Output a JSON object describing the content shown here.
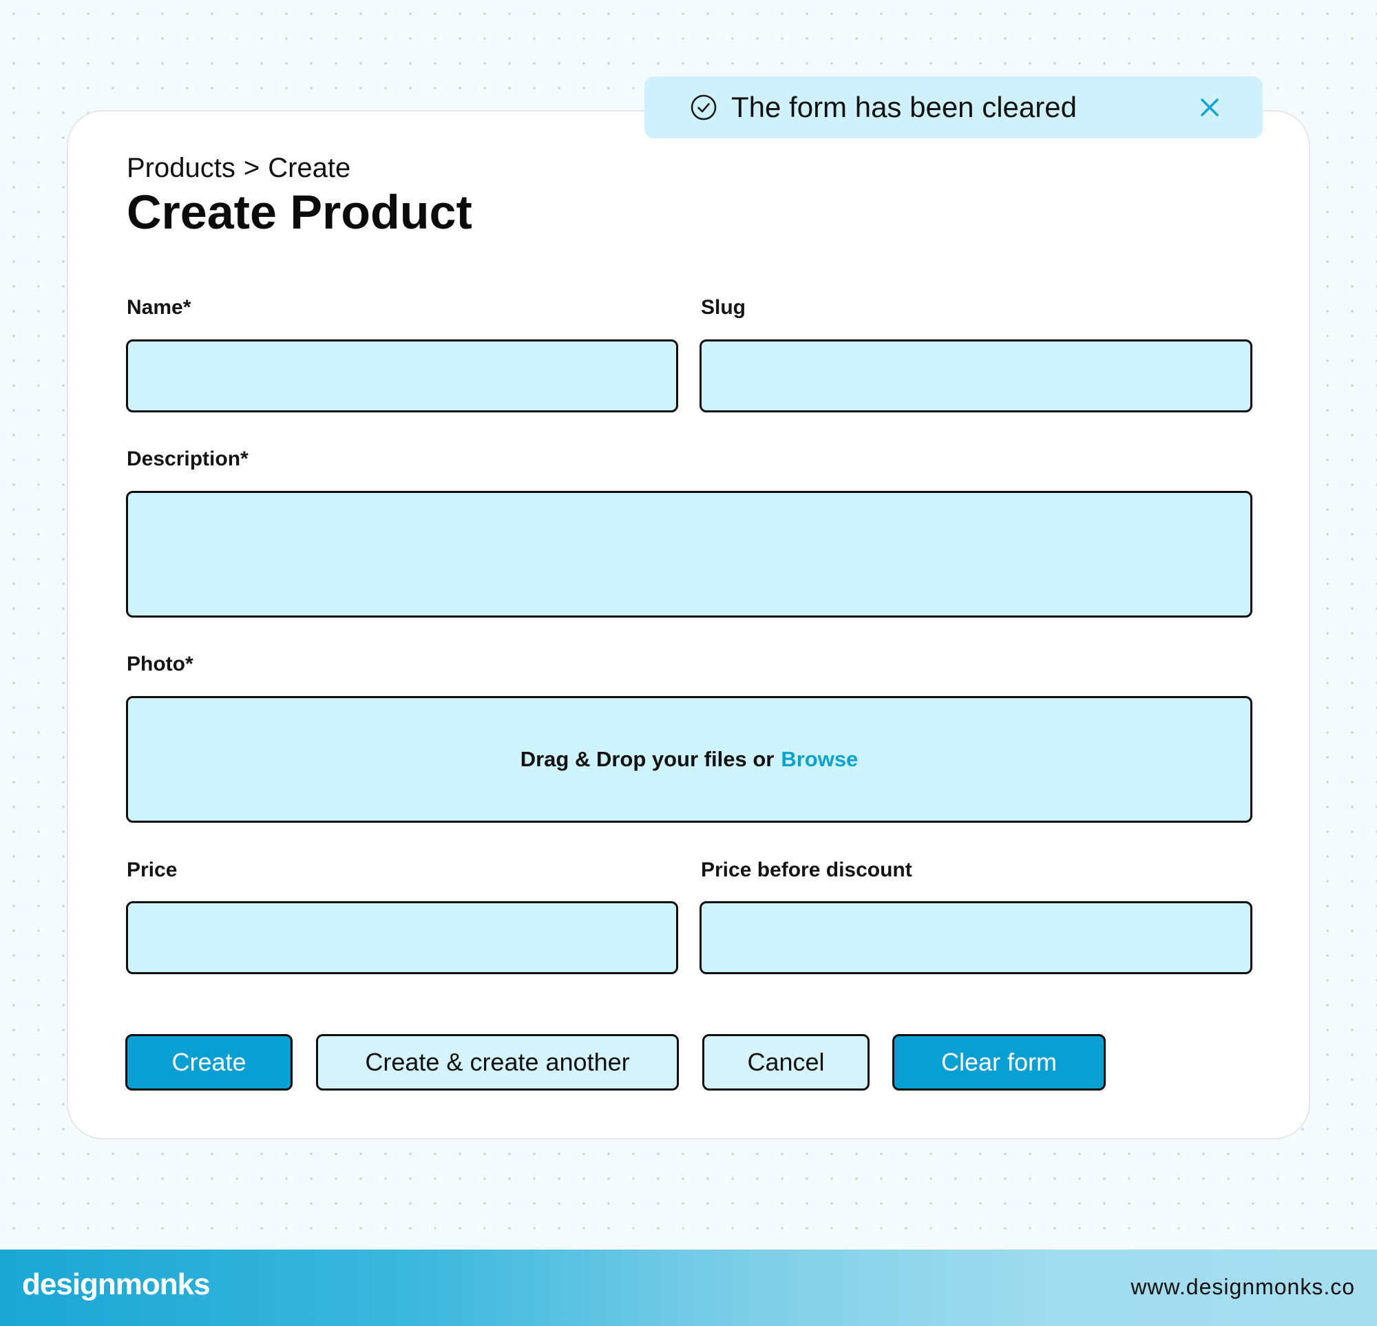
{
  "toast": {
    "message": "The form has been cleared",
    "icons": {
      "status": "check-circle-icon",
      "close": "close-icon"
    },
    "close_color": "#1aa3cc"
  },
  "breadcrumb": {
    "parent": "Products",
    "separator": ">",
    "current": "Create"
  },
  "page_title": "Create Product",
  "form": {
    "name": {
      "label": "Name*",
      "value": ""
    },
    "slug": {
      "label": "Slug",
      "value": ""
    },
    "description": {
      "label": "Description*",
      "value": ""
    },
    "photo": {
      "label": "Photo*",
      "drop_text": "Drag & Drop your files or",
      "browse_label": "Browse"
    },
    "price": {
      "label": "Price",
      "value": ""
    },
    "price_before_discount": {
      "label": "Price before discount",
      "value": ""
    }
  },
  "actions": {
    "create": "Create",
    "create_another": "Create & create another",
    "cancel": "Cancel",
    "clear": "Clear form"
  },
  "footer": {
    "brand": "designmonks",
    "website": "www.designmonks.co"
  },
  "colors": {
    "accent": "#0a9fd2",
    "field_bg": "#cff3fd",
    "toast_bg": "#cff1fb",
    "link": "#0aa3cf"
  }
}
